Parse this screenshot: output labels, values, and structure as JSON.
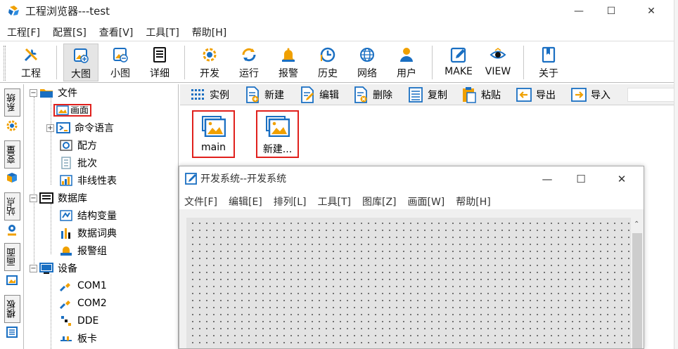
{
  "window": {
    "title": "工程浏览器---test",
    "minimize": "—",
    "maximize": "☐",
    "close": "✕"
  },
  "menubar": {
    "items": [
      "工程[F]",
      "配置[S]",
      "查看[V]",
      "工具[T]",
      "帮助[H]"
    ]
  },
  "toolbar": {
    "items": [
      {
        "label": "工程",
        "icon": "tools-icon"
      },
      {
        "label": "大图",
        "icon": "large-icons-icon",
        "active": true
      },
      {
        "label": "小图",
        "icon": "small-icons-icon"
      },
      {
        "label": "详细",
        "icon": "details-icon"
      },
      {
        "label": "开发",
        "icon": "develop-icon"
      },
      {
        "label": "运行",
        "icon": "run-icon"
      },
      {
        "label": "报警",
        "icon": "alarm-bell-icon"
      },
      {
        "label": "历史",
        "icon": "history-clock-icon"
      },
      {
        "label": "网络",
        "icon": "network-globe-icon"
      },
      {
        "label": "用户",
        "icon": "user-icon"
      },
      {
        "label": "MAKE",
        "icon": "make-edit-icon"
      },
      {
        "label": "VIEW",
        "icon": "view-eye-icon"
      },
      {
        "label": "关于",
        "icon": "about-book-icon"
      }
    ]
  },
  "side_tabs": {
    "items": [
      {
        "label": "系统",
        "icon": "system-gear-icon"
      },
      {
        "label": "变量",
        "icon": "variable-cube-icon"
      },
      {
        "label": "站点",
        "icon": "station-icon"
      },
      {
        "label": "画面",
        "icon": "screen-picture-icon"
      },
      {
        "label": "模板",
        "icon": "template-icon"
      }
    ]
  },
  "tree": {
    "nodes": [
      {
        "label": "文件",
        "icon": "folder-icon",
        "expander": "−"
      },
      {
        "label": "画面",
        "icon": "screen-picture-icon",
        "selected": true
      },
      {
        "label": "命令语言",
        "icon": "command-icon",
        "expander": "+"
      },
      {
        "label": "配方",
        "icon": "recipe-icon"
      },
      {
        "label": "批次",
        "icon": "batch-icon"
      },
      {
        "label": "非线性表",
        "icon": "nonlinear-table-icon"
      },
      {
        "label": "数据库",
        "icon": "database-icon",
        "expander": "−"
      },
      {
        "label": "结构变量",
        "icon": "struct-variable-icon"
      },
      {
        "label": "数据词典",
        "icon": "data-dictionary-icon"
      },
      {
        "label": "报警组",
        "icon": "alarm-group-icon"
      },
      {
        "label": "设备",
        "icon": "device-monitor-icon",
        "expander": "−"
      },
      {
        "label": "COM1",
        "icon": "com-port-icon"
      },
      {
        "label": "COM2",
        "icon": "com-port-icon"
      },
      {
        "label": "DDE",
        "icon": "dde-icon"
      },
      {
        "label": "板卡",
        "icon": "board-card-icon"
      }
    ]
  },
  "content_toolbar": {
    "items": [
      {
        "label": "实例",
        "icon": "instance-icon"
      },
      {
        "label": "新建",
        "icon": "new-file-icon"
      },
      {
        "label": "编辑",
        "icon": "edit-file-icon"
      },
      {
        "label": "删除",
        "icon": "delete-file-icon"
      },
      {
        "label": "复制",
        "icon": "copy-icon"
      },
      {
        "label": "粘贴",
        "icon": "paste-icon"
      },
      {
        "label": "导出",
        "icon": "export-icon"
      },
      {
        "label": "导入",
        "icon": "import-icon"
      }
    ]
  },
  "screens": {
    "items": [
      {
        "label": "main",
        "icon": "picture-icon"
      },
      {
        "label": "新建...",
        "icon": "picture-icon"
      }
    ]
  },
  "child_window": {
    "title": "开发系统--开发系统",
    "minimize": "—",
    "maximize": "☐",
    "close": "✕",
    "menu": [
      "文件[F]",
      "编辑[E]",
      "排列[L]",
      "工具[T]",
      "图库[Z]",
      "画面[W]",
      "帮助[H]"
    ],
    "scroll_up": "⌃"
  },
  "colors": {
    "highlight_border": "#e0201c",
    "icon_blue": "#1a6fc2",
    "accent_orange": "#f0a000"
  }
}
